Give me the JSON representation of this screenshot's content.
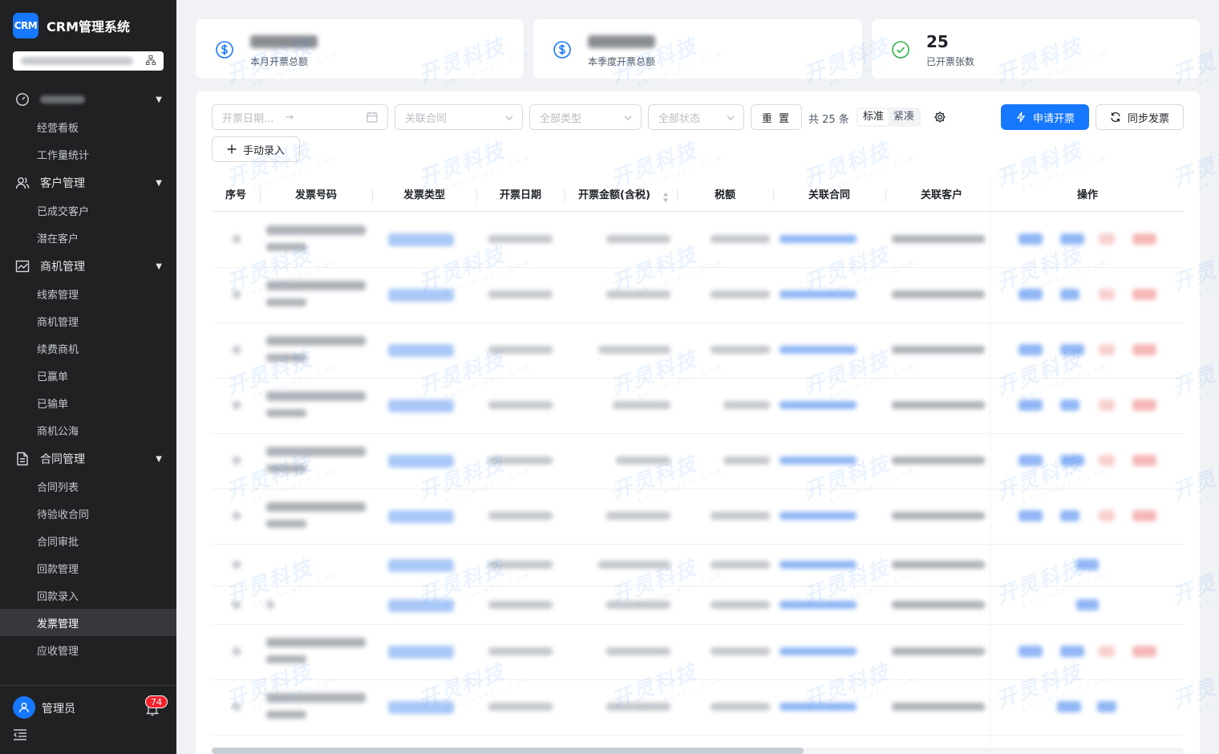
{
  "app": {
    "logo": "CRM",
    "title": "CRM管理系统"
  },
  "sidebar": {
    "groups": [
      {
        "label": "",
        "icon": "dashboard-icon",
        "items": [
          "经营看板",
          "工作量统计"
        ]
      },
      {
        "label": "客户管理",
        "icon": "customer-icon",
        "items": [
          "已成交客户",
          "潜在客户"
        ]
      },
      {
        "label": "商机管理",
        "icon": "opportunity-chart-icon",
        "items": [
          "线索管理",
          "商机管理",
          "续费商机",
          "已赢单",
          "已输单",
          "商机公海"
        ]
      },
      {
        "label": "合同管理",
        "icon": "contract-document-icon",
        "items": [
          "合同列表",
          "待验收合同",
          "合同审批",
          "回款管理",
          "回款录入",
          "发票管理",
          "应收管理"
        ]
      }
    ],
    "active_item": "发票管理"
  },
  "user": {
    "name": "管理员",
    "notification_count": "74"
  },
  "stats": [
    {
      "label": "本月开票总额",
      "icon": "dollar-circle-icon",
      "value": ""
    },
    {
      "label": "本季度开票总额",
      "icon": "dollar-circle-icon",
      "value": ""
    },
    {
      "label": "已开票张数",
      "icon": "check-circle-icon",
      "value": "25"
    }
  ],
  "filters": {
    "date_placeholder": "开票日期...",
    "date_separator": "→",
    "contract_placeholder": "关联合同",
    "type_placeholder": "全部类型",
    "status_placeholder": "全部状态",
    "reset_label": "重 置",
    "total_text": "共 25 条",
    "density_options": [
      "标准",
      "紧凑"
    ],
    "density_selected": "标准",
    "apply_label": "申请开票",
    "sync_label": "同步发票",
    "manual_label": "手动录入"
  },
  "table": {
    "columns": [
      "序号",
      "发票号码",
      "发票类型",
      "开票日期",
      "开票金额(含税)",
      "税额",
      "关联合同",
      "关联客户",
      "操作"
    ],
    "sortable_column": "开票金额(含税)",
    "row_count_visible": 10
  },
  "colors": {
    "primary": "#1677ff",
    "sidebar_bg": "#202123",
    "danger": "#f5222d"
  },
  "watermark": {
    "main": "开灵科技",
    "sub": "KAILINGKEJI.COM"
  }
}
